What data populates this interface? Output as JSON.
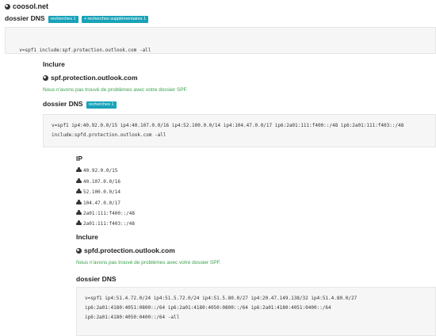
{
  "root": {
    "domain": "coosol.net",
    "dns_heading": "dossier DNS",
    "badge_lookups": "recherches 1",
    "badge_extra": "+ recherches supplémentaires 1",
    "record": "v=spf1 include:spf.protection.outlook.com -all"
  },
  "include1": {
    "heading": "Inclure",
    "domain": "spf.protection.outlook.com",
    "status": "Nous n'avons pas trouvé de problèmes avec votre dossier SPF.",
    "dns_heading": "dossier DNS",
    "badge_lookups": "recherches 1",
    "record_line1": "v=spf1 ip4:40.92.0.0/15 ip4:40.107.0.0/16 ip4:52.100.0.0/14 ip4:104.47.0.0/17 ip6:2a01:111:f400::/48 ip6:2a01:111:f403::/48",
    "record_line2": "include:spfd.protection.outlook.com -all",
    "ip_heading": "IP",
    "ips": [
      "40.92.0.0/15",
      "40.107.0.0/16",
      "52.100.0.0/14",
      "104.47.0.0/17",
      "2a01:111:f400::/48",
      "2a01:111:f403::/48"
    ]
  },
  "include2": {
    "heading": "Inclure",
    "domain": "spfd.protection.outlook.com",
    "status": "Nous n'avons pas trouvé de problèmes avec votre dossier SPF.",
    "dns_heading": "dossier DNS",
    "record_line1": "v=spf1 ip4:51.4.72.0/24 ip4:51.5.72.0/24 ip4:51.5.80.0/27 ip4:20.47.149.138/32 ip4:51.4.80.0/27",
    "record_line2": "ip6:2a01:4180:4051:0800::/64 ip6:2a01:4180:4050:0800::/64 ip6:2a01:4180:4051:0400::/64",
    "record_line3": "ip6:2a01:4180:4050:0400::/64 -all"
  },
  "icons": {
    "domain": "globe-icon",
    "ip": "cloud-icon"
  },
  "colors": {
    "badge": "#17a2b8",
    "ok": "#3aa14a"
  }
}
